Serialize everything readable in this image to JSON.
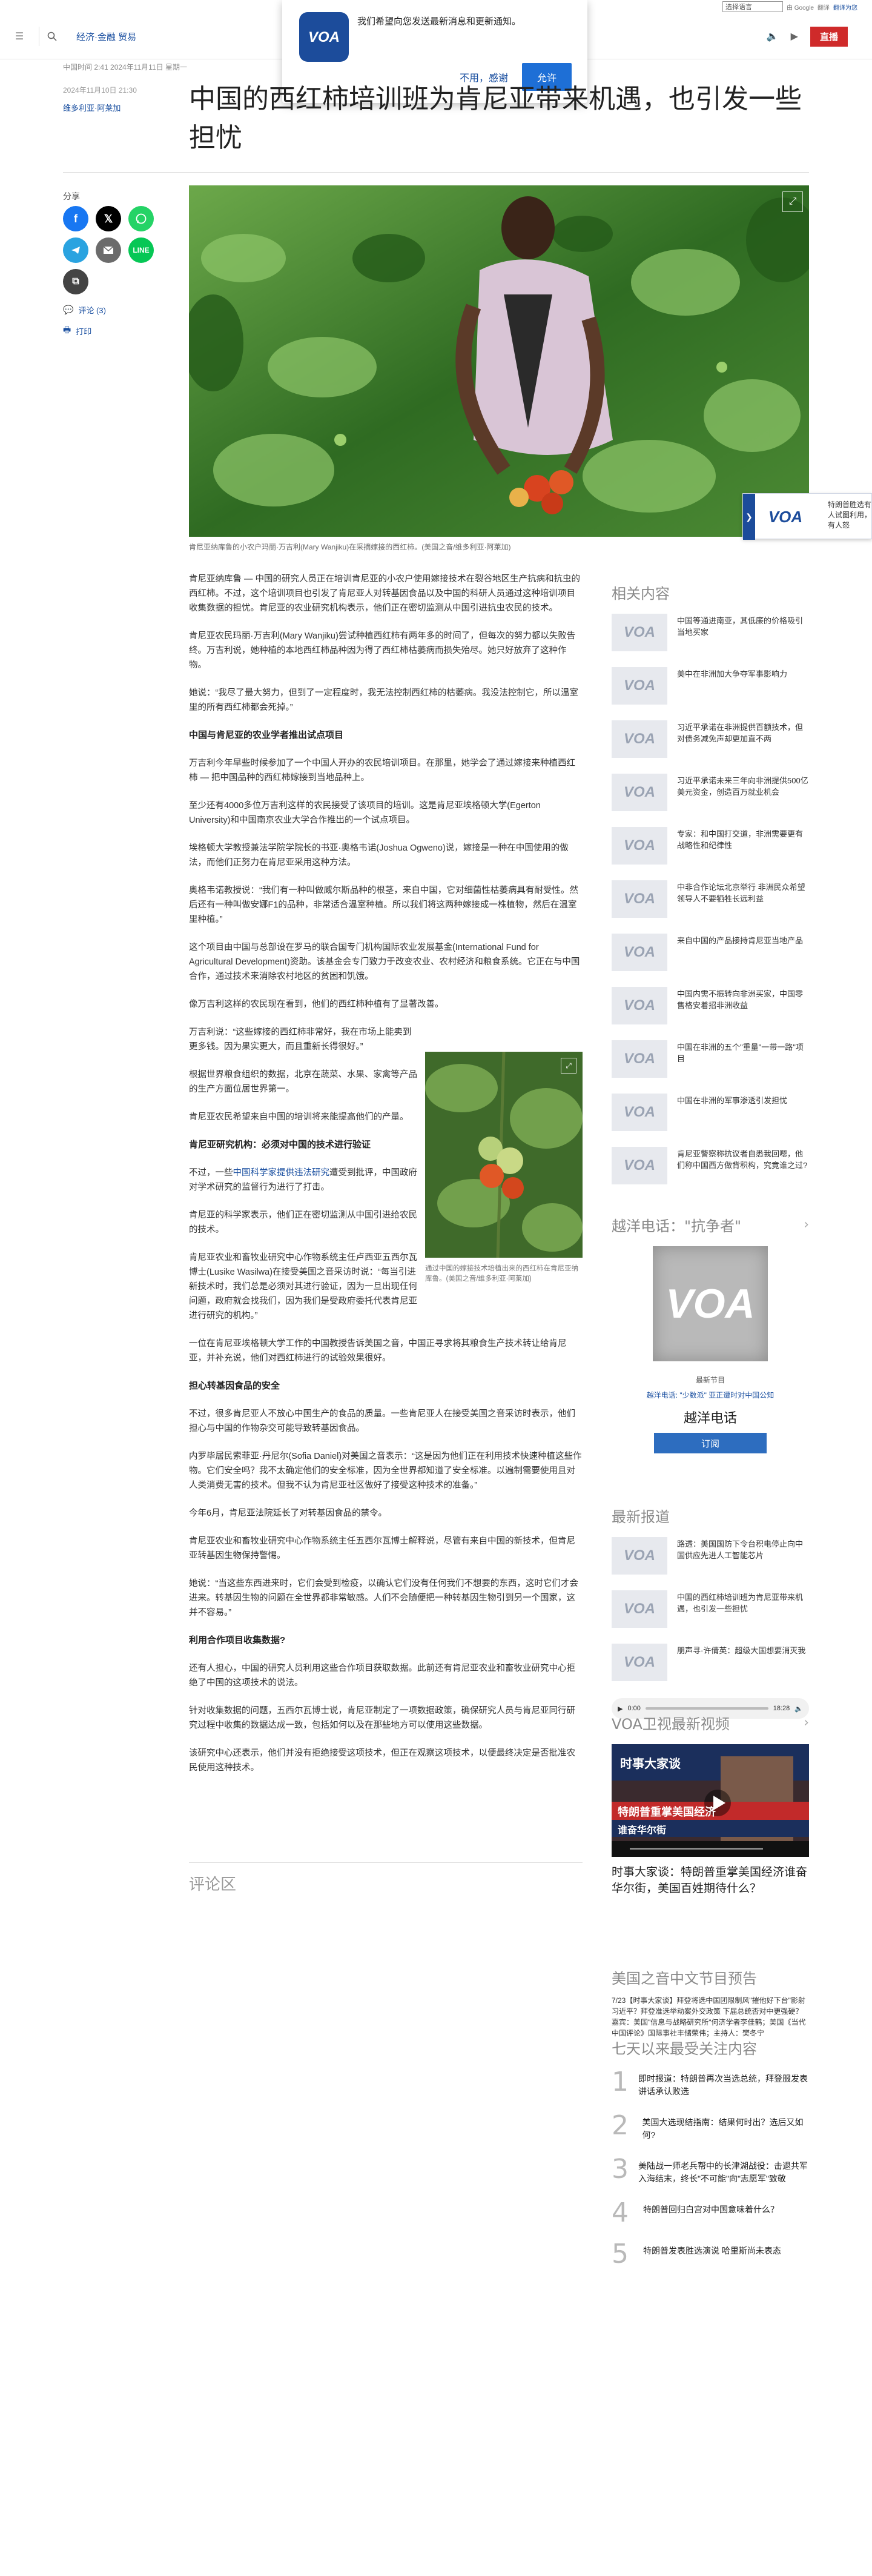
{
  "utility": {
    "language_select": "选择语言",
    "google_label": "由 Google",
    "translate_label": "翻译",
    "powered_link": "翻译为您"
  },
  "header": {
    "section": "经济·金融 贸易",
    "live_label": "直播"
  },
  "notification": {
    "message": "我们希望向您发送最新消息和更新通知。",
    "decline": "不用，感谢",
    "accept": "允许"
  },
  "article": {
    "meta_time": "中国时间 2:41 2024年11月11日 星期一",
    "date": "2024年11月10日 21:30",
    "author": "维多利亚·阿莱加",
    "title": "中国的西红柿培训班为肯尼亚带来机遇，也引发一些担忧",
    "hero_caption": "肯尼亚纳库鲁的小农户玛丽·万吉利(Mary Wanjiku)在采摘嫁接的西红柿。(美国之音/维多利亚·阿莱加)",
    "inline_caption": "通过中国的嫁接技术培植出来的西红柿在肯尼亚纳库鲁。(美国之音/维多利亚·阿莱加)",
    "paragraphs": {
      "p1": "肯尼亚纳库鲁 — 中国的研究人员正在培训肯尼亚的小农户使用嫁接技术在裂谷地区生产抗病和抗虫的西红柿。不过，这个培训项目也引发了肯尼亚人对转基因食品以及中国的科研人员通过这种培训项目收集数据的担忧。肯尼亚的农业研究机构表示，他们正在密切监测从中国引进抗虫农民的技术。",
      "p2": "肯尼亚农民玛丽·万吉利(Mary Wanjiku)尝试种植西红柿有两年多的时间了，但每次的努力都以失败告终。万吉利说，她种植的本地西红柿品种因为得了西红柿枯萎病而损失殆尽。她只好放弃了这种作物。",
      "p3": "她说：“我尽了最大努力，但到了一定程度时，我无法控制西红柿的枯萎病。我没法控制它，所以温室里的所有西红柿都会死掉。”",
      "h1": "中国与肯尼亚的农业学者推出试点项目",
      "p4": "万吉利今年早些时候参加了一个中国人开办的农民培训项目。在那里，她学会了通过嫁接来种植西红柿 — 把中国品种的西红柿嫁接到当地品种上。",
      "p5": "至少还有4000多位万吉利这样的农民接受了该项目的培训。这是肯尼亚埃格顿大学(Egerton University)和中国南京农业大学合作推出的一个试点项目。",
      "p6": "埃格顿大学教授兼法学院学院长的书亚·奥格韦诺(Joshua Ogweno)说，嫁接是一种在中国使用的做法，而他们正努力在肯尼亚采用这种方法。",
      "p7": "奥格韦诺教授说：“我们有一种叫做威尔斯品种的根茎，来自中国，它对细菌性枯萎病具有耐受性。然后还有一种叫做安娜F1的品种，非常适合温室种植。所以我们将这两种嫁接成一株植物，然后在温室里种植。”",
      "p8": "这个项目由中国与总部设在罗马的联合国专门机构国际农业发展基金(International Fund for Agricultural Development)资助。该基金会专门致力于改变农业、农村经济和粮食系统。它正在与中国合作，通过技术来消除农村地区的贫困和饥饿。",
      "p9": "像万吉利这样的农民现在看到，他们的西红柿种植有了显著改善。",
      "p10": "万吉利说：“这些嫁接的西红柿非常好，我在市场上能卖到更多钱。因为果实更大，而且重新长得很好。”",
      "p11": "根据世界粮食组织的数据，北京在蔬菜、水果、家禽等产品的生产方面位居世界第一。",
      "p12": "肯尼亚农民希望来自中国的培训将来能提高他们的产量。",
      "h2": "肯尼亚研究机构：必须对中国的技术进行验证",
      "p13a": "不过，一些",
      "p13link": "中国科学家提供违法研究",
      "p13b": "遭受到批评，中国政府对学术研究的监督行为进行了打击。",
      "p14": "肯尼亚的科学家表示，他们正在密切监测从中国引进给农民的技术。",
      "p15": "肯尼亚农业和畜牧业研究中心作物系统主任卢西亚五西尔瓦博士(Lusike Wasilwa)在接受美国之音采访时说：“每当引进新技术时，我们总是必须对其进行验证，因为一旦出现任何问题，政府就会找我们，因为我们是受政府委托代表肯尼亚进行研究的机构。”",
      "p16": "一位在肯尼亚埃格顿大学工作的中国教授告诉美国之音，中国正寻求将其粮食生产技术转让给肯尼亚，并补充说，他们对西红柿进行的试验效果很好。",
      "h3": "担心转基因食品的安全",
      "p17": "不过，很多肯尼亚人不放心中国生产的食品的质量。一些肯尼亚人在接受美国之音采访时表示，他们担心与中国的作物杂交可能导致转基因食品。",
      "p18": "内罗毕居民索菲亚·丹尼尔(Sofia Daniel)对美国之音表示：“这是因为他们正在利用技术快速种植这些作物。它们安全吗？我不太确定他们的安全标准，因为全世界都知道了安全标准。以遍制需要使用且对人类消费无害的技术。但我不认为肯尼亚社区做好了接受这种技术的准备。”",
      "p19": "今年6月，肯尼亚法院延长了对转基因食品的禁令。",
      "p20": "肯尼亚农业和畜牧业研究中心作物系统主任五西尔瓦博士解释说，尽管有来自中国的新技术，但肯尼亚转基因生物保持警惕。",
      "p21": "她说：“当这些东西进来时，它们会受到检疫，以确认它们没有任何我们不想要的东西，这时它们才会进来。转基因生物的问题在全世界都非常敏感。人们不会随便把一种转基因生物引到另一个国家，这并不容易。”",
      "h4": "利用合作项目收集数据?",
      "p22": "还有人担心，中国的研究人员利用这些合作项目获取数据。此前还有肯尼亚农业和畜牧业研究中心拒绝了中国的这项技术的说法。",
      "p23": "针对收集数据的问题，五西尔瓦博士说，肯尼亚制定了一项数据政策，确保研究人员与肯尼亚同行研究过程中收集的数据达成一致，包括如何以及在那些地方可以使用这些数据。",
      "p24": "该研究中心还表示，他们并没有拒绝接受这项技术，但正在观察这项技术，以便最终决定是否批准农民使用这种技术。"
    }
  },
  "share": {
    "label": "分享",
    "comments": "评论 (3)",
    "print": "打印"
  },
  "side_popup": {
    "text": "特朗普胜选有人试图利用，有人怒"
  },
  "rail": {
    "related_heading": "相关内容",
    "related": [
      "中国等通进南亚，其低廉的价格吸引当地买家",
      "美中在非洲加大争夺军事影响力",
      "习近平承诺在非洲提供百额技术，但对债务减免声却更加直不两",
      "习近平承诺未来三年向非洲提供500亿美元资金，创造百万就业机会",
      "专家：和中国打交道，非洲需要更有战略性和纪律性",
      "中非合作论坛北京举行 非洲民众希望领导人不要牺牲长远利益",
      "来自中国的产品接持肯尼亚当地产品",
      "中国内需不振转向非洲买家，中国零售格安着招非洲收益",
      "中国在非洲的五个\"重量\"一带一路\"项目",
      "中国在非洲的军事渗透引发担忧",
      "肯尼亚警察称抗议者自悉我回嗯，他们称中国西方做背积构，究竟谁之过?"
    ],
    "podcast_heading": "越洋电话：\"抗争者\"",
    "podcast_label": "最新节目",
    "podcast_links": "越洋电话: \"少数派\" 亚正遭时对中国公知",
    "podcast_title": "越洋电话",
    "podcast_subscribe": "订阅",
    "latest_heading": "最新报道",
    "latest": [
      "路透：美国国防下令台积电停止向中国供应先进人工智能芯片",
      "中国的西红柿培训班为肯尼亚带来机遇，也引发一些担忧",
      "朋声寻·许倩英：超级大国想要消灭我"
    ],
    "audio_time": "0:00",
    "audio_total": "18:28",
    "video_heading": "VOA卫视最新视频",
    "video_title": "时事大家谈：特朗普重掌美国经济谁奋华尔街，美国百姓期待什么？",
    "video_banner": "时事大家谈",
    "video_overlay_1": "特朗普重掌美国经济",
    "video_overlay_2": "谁奋华尔街",
    "schedule_heading": "美国之音中文节目预告",
    "schedule_text": "7/23【时事大家谈】拜登将选中国团限制风\"摧他好下台\"影射习近平？拜登准选举动案外交政策 下届总统否对中更强硬？ 嘉宾：美国\"信息与战略研究所\"何济学者李佳鹤；美国《当代中国评论》国际事社丰储荣伟；主持人：樊冬宁",
    "most_heading": "七天以来最受关注内容",
    "most": [
      {
        "n": "1",
        "t": "即时报道：特朗普再次当选总统，拜登服发表讲话承认败选"
      },
      {
        "n": "2",
        "t": "美国大选现结指南：结果何时出？选后又如何?"
      },
      {
        "n": "3",
        "t": "美陆战一师老兵帮中的长津湖战役：击退共军入海结末，终长\"不可能\"向\"志愿军\"致敬"
      },
      {
        "n": "4",
        "t": "特朗普回归白宫对中国意味着什么？"
      },
      {
        "n": "5",
        "t": "特朗普发表胜选演说 哈里斯尚未表态"
      }
    ],
    "comments_heading": "评论区"
  },
  "colors": {
    "accent": "#1a4fa0",
    "live": "#cf2a2a",
    "brand": "#1c4c9b"
  }
}
